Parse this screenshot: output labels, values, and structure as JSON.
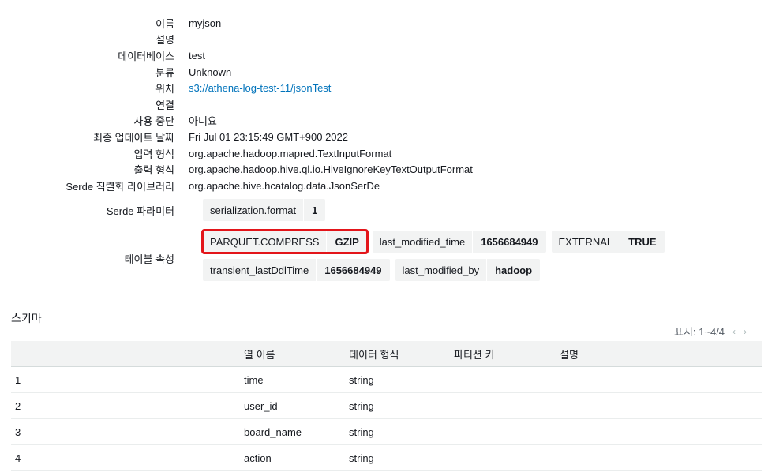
{
  "details": [
    {
      "label": "이름",
      "value": "myjson"
    },
    {
      "label": "설명",
      "value": ""
    },
    {
      "label": "데이터베이스",
      "value": "test"
    },
    {
      "label": "분류",
      "value": "Unknown"
    },
    {
      "label": "위치",
      "value": "s3://athena-log-test-11/jsonTest",
      "link": true
    },
    {
      "label": "연결",
      "value": ""
    },
    {
      "label": "사용 중단",
      "value": "아니요"
    },
    {
      "label": "최종 업데이트 날짜",
      "value": "Fri Jul 01 23:15:49 GMT+900 2022"
    },
    {
      "label": "입력 형식",
      "value": "org.apache.hadoop.mapred.TextInputFormat"
    },
    {
      "label": "출력 형식",
      "value": "org.apache.hadoop.hive.ql.io.HiveIgnoreKeyTextOutputFormat"
    },
    {
      "label": "Serde 직렬화 라이브러리",
      "value": "org.apache.hive.hcatalog.data.JsonSerDe"
    }
  ],
  "serde": {
    "label": "Serde 파라미터",
    "tags": [
      {
        "key": "serialization.format",
        "value": "1"
      }
    ]
  },
  "table_props": {
    "label": "테이블 속성",
    "line1": [
      {
        "key": "PARQUET.COMPRESS",
        "value": "GZIP",
        "highlighted": true
      },
      {
        "key": "last_modified_time",
        "value": "1656684949"
      },
      {
        "key": "EXTERNAL",
        "value": "TRUE"
      }
    ],
    "line2": [
      {
        "key": "transient_lastDdlTime",
        "value": "1656684949"
      },
      {
        "key": "last_modified_by",
        "value": "hadoop"
      }
    ]
  },
  "schema": {
    "title": "스키마",
    "pager": "표시: 1~4/4",
    "headers": [
      "",
      "열 이름",
      "데이터 형식",
      "파티션 키",
      "설명"
    ],
    "rows": [
      [
        "1",
        "time",
        "string",
        "",
        ""
      ],
      [
        "2",
        "user_id",
        "string",
        "",
        ""
      ],
      [
        "3",
        "board_name",
        "string",
        "",
        ""
      ],
      [
        "4",
        "action",
        "string",
        "",
        ""
      ]
    ]
  },
  "colors": {
    "link": "#0073bb",
    "highlight": "#e3151a",
    "tag_bg": "#f2f3f3"
  }
}
